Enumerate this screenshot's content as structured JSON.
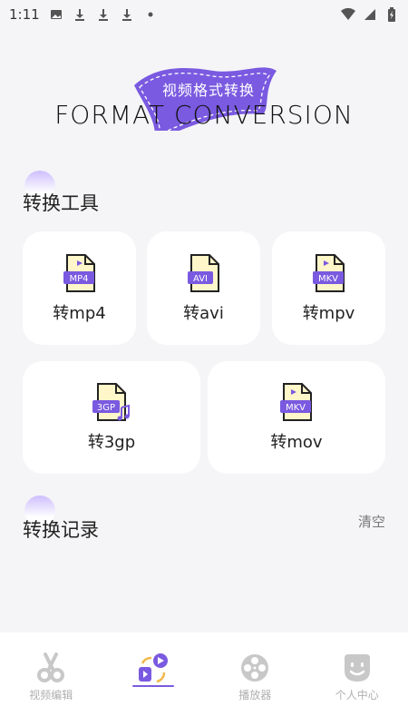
{
  "status_bar": {
    "time": "1:11",
    "icons": [
      "image-icon",
      "download-icon",
      "download-icon",
      "download-icon",
      "dot-icon"
    ],
    "right_icons": [
      "wifi-icon",
      "signal-icon",
      "battery-icon"
    ]
  },
  "header": {
    "flag_text": "视频格式转换",
    "title": "FORMAT CONVERSION",
    "accent_color": "#7a5ae0"
  },
  "tools_section": {
    "title": "转换工具",
    "items": [
      {
        "label": "转mp4",
        "badge": "MP4",
        "icon": "mp4-file-icon"
      },
      {
        "label": "转avi",
        "badge": "AVI",
        "icon": "avi-file-icon"
      },
      {
        "label": "转mpv",
        "badge": "MKV",
        "icon": "mkv-file-icon"
      },
      {
        "label": "转3gp",
        "badge": "3GP",
        "icon": "3gp-file-icon"
      },
      {
        "label": "转mov",
        "badge": "MKV",
        "icon": "mov-file-icon"
      }
    ]
  },
  "history_section": {
    "title": "转换记录",
    "clear_label": "清空"
  },
  "bottom_nav": {
    "items": [
      {
        "label": "视频编辑",
        "icon": "scissors-icon",
        "active": false
      },
      {
        "label": "",
        "icon": "convert-icon",
        "active": true
      },
      {
        "label": "播放器",
        "icon": "film-reel-icon",
        "active": false
      },
      {
        "label": "个人中心",
        "icon": "face-icon",
        "active": false
      }
    ]
  }
}
